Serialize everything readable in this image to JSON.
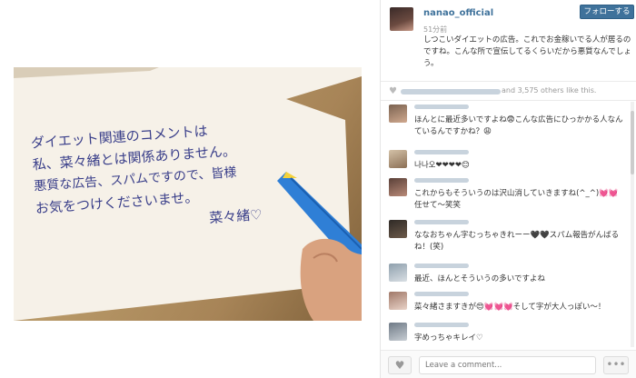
{
  "post": {
    "username": "nanao_official",
    "follow_label": "フォローする",
    "time": "51分前",
    "caption": "しつこいダイエットの広告。これでお金稼いでる人が居るのですね。こんな所で宣伝してるくらいだから悪質なんでしょう。"
  },
  "photo": {
    "note_lines": [
      "ダイエット関連のコメントは",
      "私、菜々緒とは関係ありません。",
      "悪質な広告、スパムですので、皆様",
      "お気をつけくださいませ。",
      "菜々緒♡"
    ]
  },
  "likes": {
    "text": "and 3,575 others like this."
  },
  "comments": [
    {
      "text": "ほんとに最近多いですよね😨こんな広告にひっかかる人なんているんですかね？😩"
    },
    {
      "text": "나나오❤❤❤❤😊"
    },
    {
      "text": "これからもそういうのは沢山消していきますね(^_^)💓💓任せて〜笑笑"
    },
    {
      "text": "ななおちゃん字むっちゃきれーー🖤🖤スパム報告がんばるね！(笑)"
    },
    {
      "text": "最近、ほんとそういうの多いですよね"
    },
    {
      "text": "菜々緒さますきが😍💓💓💓そして字が大人っぽい〜！"
    },
    {
      "text": "字めっちゃキレイ♡"
    }
  ],
  "footer": {
    "input_placeholder": "Leave a comment...",
    "more_label": "•••"
  },
  "colors": {
    "link": "#3f729b",
    "follow_bg": "#3f729b"
  }
}
